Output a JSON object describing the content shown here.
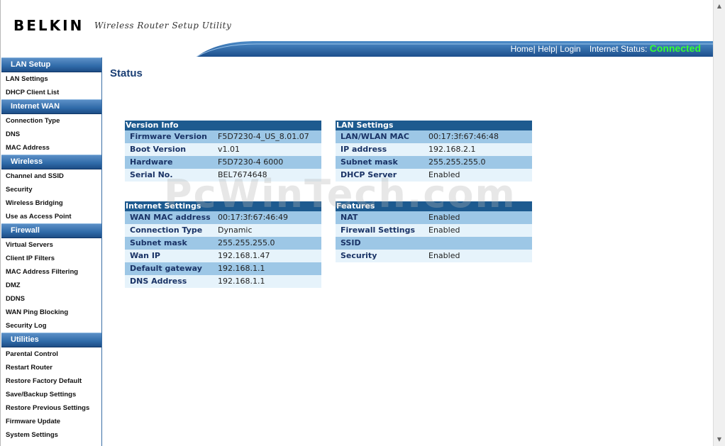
{
  "header": {
    "logo": "BELKIN",
    "tagline": "Wireless Router Setup Utility",
    "links": {
      "home": "Home|",
      "help": " Help|",
      "login": " Login"
    },
    "internet_status_label": "Internet Status:",
    "internet_status_value": "Connected",
    "status_color": "#33ff33"
  },
  "sidebar": {
    "sections": [
      {
        "title": "LAN Setup",
        "items": [
          "LAN Settings",
          "DHCP Client List"
        ]
      },
      {
        "title": "Internet WAN",
        "items": [
          "Connection Type",
          "DNS",
          "MAC Address"
        ]
      },
      {
        "title": "Wireless",
        "items": [
          "Channel and SSID",
          "Security",
          "Wireless Bridging",
          "Use as Access Point"
        ]
      },
      {
        "title": "Firewall",
        "items": [
          "Virtual Servers",
          "Client IP Filters",
          "MAC Address Filtering",
          "DMZ",
          "DDNS",
          "WAN Ping Blocking",
          "Security Log"
        ]
      },
      {
        "title": "Utilities",
        "items": [
          "Parental Control",
          "Restart Router",
          "Restore Factory Default",
          "Save/Backup Settings",
          "Restore Previous Settings",
          "Firmware Update",
          "System Settings"
        ]
      }
    ]
  },
  "main": {
    "title": "Status",
    "version_info": {
      "title": "Version Info",
      "rows": [
        {
          "label": "Firmware Version",
          "value": "F5D7230-4_US_8.01.07"
        },
        {
          "label": "Boot Version",
          "value": "v1.01"
        },
        {
          "label": "Hardware",
          "value": "F5D7230-4 6000"
        },
        {
          "label": "Serial No.",
          "value": "BEL7674648"
        }
      ]
    },
    "lan_settings": {
      "title": "LAN Settings",
      "rows": [
        {
          "label": "LAN/WLAN MAC",
          "value": "00:17:3f:67:46:48"
        },
        {
          "label": "IP address",
          "value": "192.168.2.1"
        },
        {
          "label": "Subnet mask",
          "value": "255.255.255.0"
        },
        {
          "label": "DHCP Server",
          "value": "Enabled"
        }
      ]
    },
    "internet_settings": {
      "title": "Internet Settings",
      "rows": [
        {
          "label": "WAN MAC address",
          "value": "00:17:3f:67:46:49"
        },
        {
          "label": "Connection Type",
          "value": "Dynamic"
        },
        {
          "label": "Subnet mask",
          "value": "255.255.255.0"
        },
        {
          "label": "Wan IP",
          "value": "192.168.1.47"
        },
        {
          "label": "Default gateway",
          "value": "192.168.1.1"
        },
        {
          "label": "DNS Address",
          "value": "192.168.1.1"
        }
      ]
    },
    "features": {
      "title": "Features",
      "rows": [
        {
          "label": "NAT",
          "value": "Enabled"
        },
        {
          "label": "Firewall Settings",
          "value": "Enabled"
        },
        {
          "label": "SSID",
          "value": ""
        },
        {
          "label": "Security",
          "value": "Enabled"
        }
      ]
    }
  },
  "watermark": "PcWinTech.com",
  "colors": {
    "nav_blue": "#2f6aa8",
    "title_blue": "#1a3e74",
    "row_dark": "#9dc7e6",
    "row_light": "#e6f3fb"
  }
}
